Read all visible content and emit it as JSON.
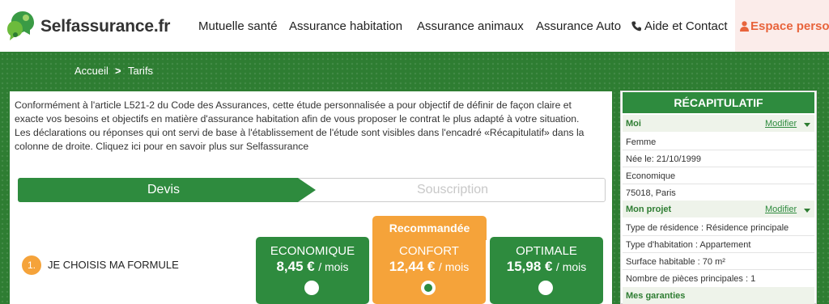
{
  "header": {
    "brand": "Selfassurance.fr",
    "nav": [
      {
        "label": "Mutuelle santé"
      },
      {
        "label": "Assurance habitation"
      },
      {
        "label": "Assurance animaux"
      },
      {
        "label": "Assurance Auto"
      },
      {
        "label": "Aide et Contact"
      }
    ],
    "espace_label": "Espace perso"
  },
  "breadcrumb": {
    "home": "Accueil",
    "separator": ">",
    "current": "Tarifs"
  },
  "intro": "Conformément à l'article L521-2 du Code des Assurances, cette étude personnalisée a pour objectif de définir de façon claire et exacte vos besoins et objectifs en matière d'assurance habitation afin de vous proposer le contrat le plus adapté à votre situation. Les déclarations ou réponses qui ont servi de base à l'établissement de l'étude sont visibles dans l'encadré «Récapitulatif» dans la colonne de droite. Cliquez ici pour en savoir plus sur Selfassurance",
  "steps": {
    "active": "Devis",
    "next": "Souscription"
  },
  "formule": {
    "number": "1.",
    "title": "JE CHOISIS MA FORMULE",
    "recommended_label": "Recommandée"
  },
  "plans": [
    {
      "name": "ECONOMIQUE",
      "price": "8,45 €",
      "period": "/ mois",
      "selected": false
    },
    {
      "name": "CONFORT",
      "price": "12,44 €",
      "period": "/ mois",
      "selected": true
    },
    {
      "name": "OPTIMALE",
      "price": "15,98 €",
      "period": "/ mois",
      "selected": false
    }
  ],
  "recap": {
    "title": "RÉCAPITULATIF",
    "moi": {
      "title": "Moi",
      "modify": "Modifier",
      "rows": [
        "Femme",
        "Née le: 21/10/1999",
        "Economique",
        "75018, Paris"
      ]
    },
    "projet": {
      "title": "Mon projet",
      "modify": "Modifier",
      "rows": [
        "Type de résidence : Résidence principale",
        "Type d'habitation : Appartement",
        "Surface habitable : 70 m²",
        "Nombre de pièces principales : 1"
      ]
    },
    "garanties": {
      "title": "Mes garanties"
    }
  },
  "colors": {
    "brand_green": "#2e8b3e",
    "accent_orange": "#f5a33a",
    "espace_red": "#e8643c"
  }
}
